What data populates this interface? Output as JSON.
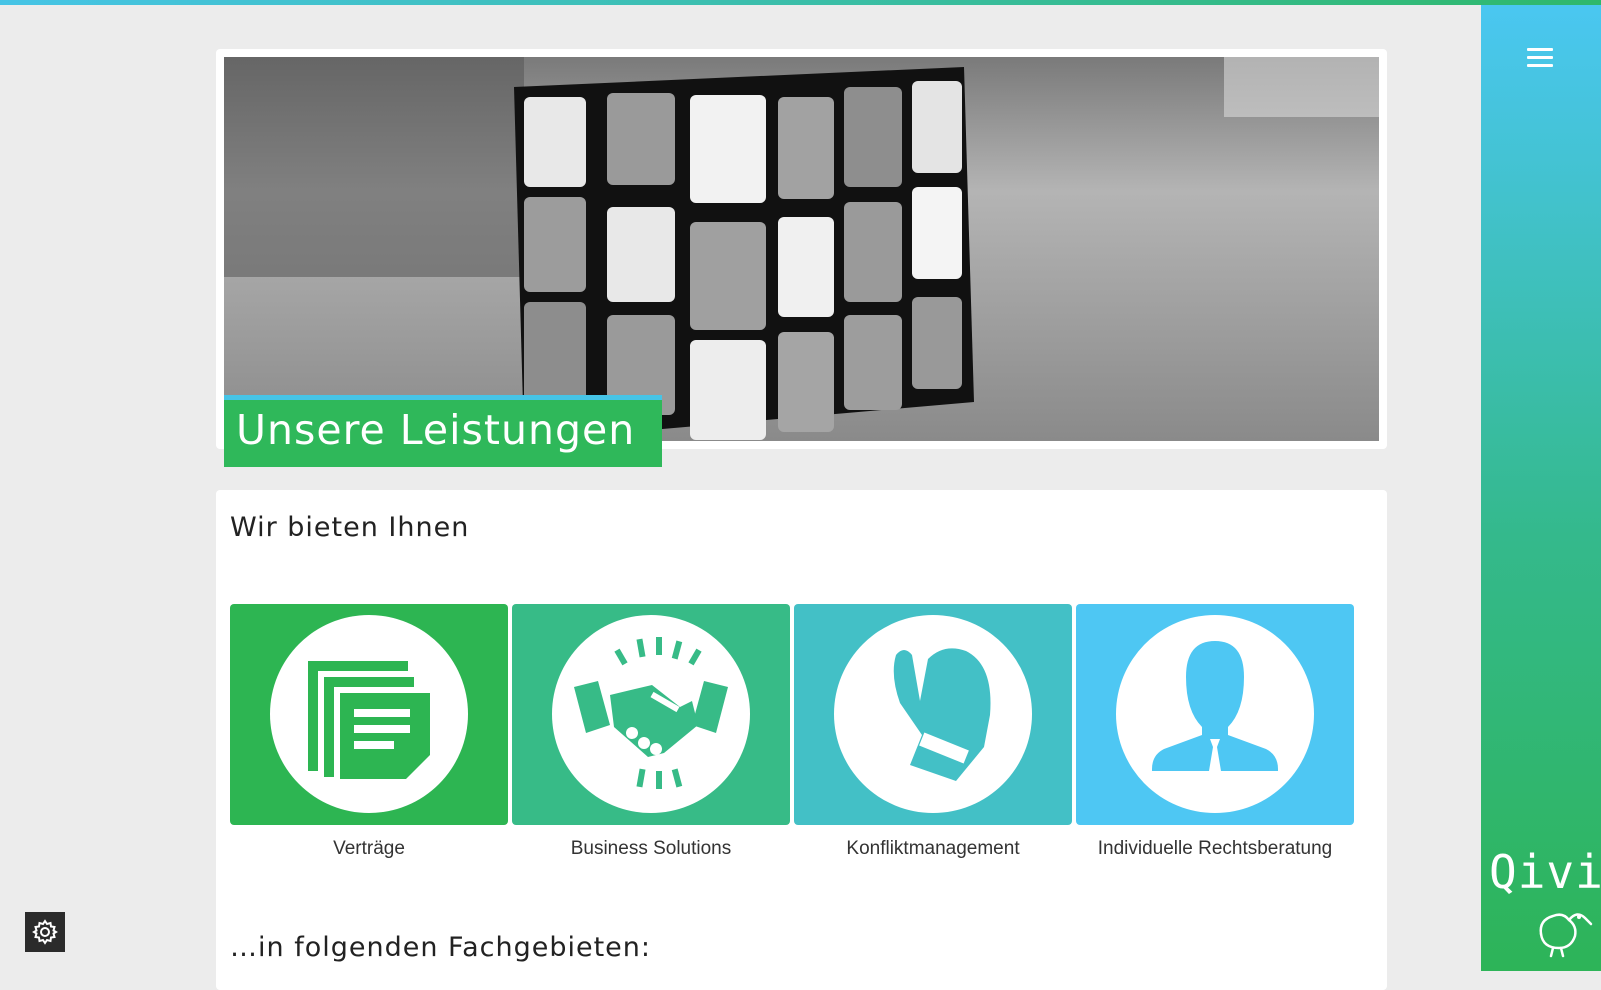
{
  "hero": {
    "title": "Unsere Leistungen"
  },
  "section": {
    "heading": "Wir bieten Ihnen",
    "subheading": "…in folgenden Fachgebieten:"
  },
  "tiles": [
    {
      "label": "Verträge",
      "icon": "documents-icon",
      "color": "#2db552"
    },
    {
      "label": "Business Solutions",
      "icon": "handshake-icon",
      "color": "#37bb87"
    },
    {
      "label": "Konfliktmanagement",
      "icon": "boxing-glove-icon",
      "color": "#43c0c6"
    },
    {
      "label": "Individuelle Rechtsberatung",
      "icon": "person-icon",
      "color": "#4ec7f3"
    }
  ],
  "sidebar": {
    "brand": "Qivi",
    "menu_icon": "hamburger-icon",
    "logo_icon": "kiwi-bird-icon"
  },
  "colors": {
    "accent_blue": "#46c4e6",
    "accent_green": "#2fb85a"
  },
  "settings": {
    "icon": "gear-icon"
  }
}
